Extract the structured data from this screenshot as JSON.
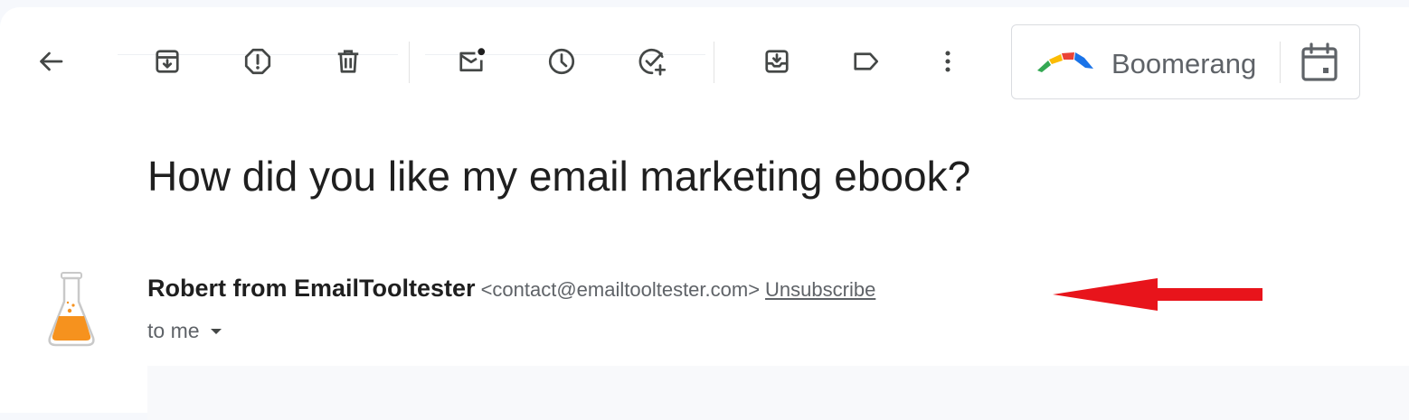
{
  "toolbar": {
    "buttons": [
      {
        "name": "back-button",
        "icon": "arrow-left-icon"
      },
      {
        "name": "archive-button",
        "icon": "archive-icon"
      },
      {
        "name": "report-spam-button",
        "icon": "report-icon"
      },
      {
        "name": "delete-button",
        "icon": "trash-icon"
      },
      {
        "name": "mark-unread-button",
        "icon": "mark-unread-icon"
      },
      {
        "name": "snooze-button",
        "icon": "clock-icon"
      },
      {
        "name": "add-to-tasks-button",
        "icon": "add-task-icon"
      },
      {
        "name": "move-to-button",
        "icon": "move-to-icon"
      },
      {
        "name": "labels-button",
        "icon": "label-icon"
      },
      {
        "name": "more-button",
        "icon": "more-vert-icon"
      }
    ]
  },
  "boomerang": {
    "label": "Boomerang",
    "logo_colors": [
      "#34a853",
      "#fbbc04",
      "#ea4335",
      "#4285f4"
    ]
  },
  "email": {
    "subject": "How did you like my email marketing ebook?",
    "sender_name": "Robert from EmailTooltester",
    "sender_email": "<contact@emailtooltester.com>",
    "unsubscribe": "Unsubscribe",
    "recipient": "to me"
  },
  "colors": {
    "annotation_arrow": "#e8141b",
    "avatar_liquid": "#f6921e"
  }
}
